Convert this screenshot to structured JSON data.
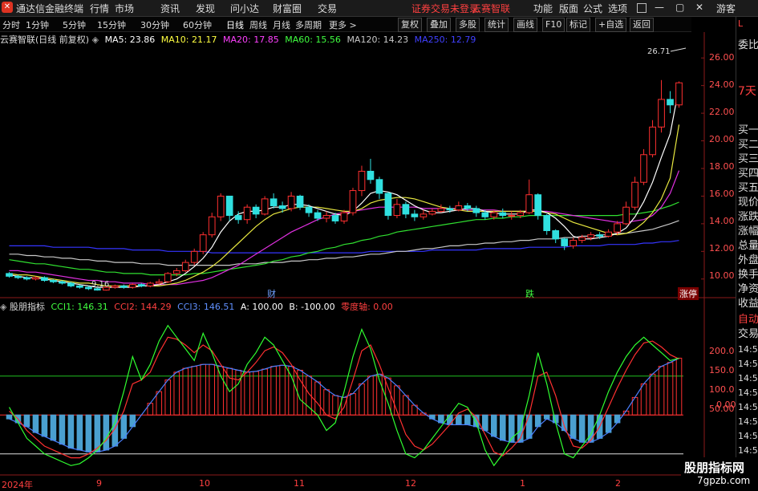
{
  "app": {
    "title": "通达信金融终端",
    "menu": [
      "行情",
      "市场",
      "资讯",
      "发现",
      "问小达",
      "财富圈",
      "交易"
    ],
    "notice": "证券交易未登录",
    "brand": "云赛智联",
    "right_menu": [
      "功能",
      "版面",
      "公式",
      "选项"
    ],
    "guest": "游客"
  },
  "toolbar": {
    "timeframes": [
      "分时",
      "1分钟",
      "5分钟",
      "15分钟",
      "30分钟",
      "60分钟",
      "日线",
      "周线",
      "月线",
      "多周期",
      "更多 >"
    ],
    "active": "日线",
    "buttons": [
      "复权",
      "叠加",
      "多股",
      "统计",
      "画线",
      "F10",
      "标记",
      "+自选",
      "返回"
    ]
  },
  "ma_legend": {
    "name": "云赛智联(日线 前复权)",
    "items": [
      {
        "label": "MA5: 23.86",
        "color": "#ffffff"
      },
      {
        "label": "MA10: 21.17",
        "color": "#ffff40"
      },
      {
        "label": "MA20: 17.85",
        "color": "#ff40ff"
      },
      {
        "label": "MA60: 15.56",
        "color": "#40ff40"
      },
      {
        "label": "MA120: 14.23",
        "color": "#c8c8c8"
      },
      {
        "label": "MA250: 12.79",
        "color": "#4040ff"
      }
    ]
  },
  "cci_legend": {
    "name": "股朋指标",
    "items": [
      {
        "label": "CCI1: 146.31",
        "color": "#40ff40"
      },
      {
        "label": "CCI2: 144.29",
        "color": "#ff4040"
      },
      {
        "label": "CCI3: 146.51",
        "color": "#6090ff"
      },
      {
        "label": "A: 100.00",
        "color": "#ffffff"
      },
      {
        "label": "B: -100.00",
        "color": "#ffffff"
      },
      {
        "label": "零度轴: 0.00",
        "color": "#ff4040"
      }
    ]
  },
  "price_axis": [
    "26.00",
    "24.00",
    "22.00",
    "20.00",
    "18.00",
    "16.00",
    "14.00",
    "12.00",
    "10.00"
  ],
  "cci_axis": [
    "200.0",
    "150.0",
    "100.0",
    "50.00",
    "0.00"
  ],
  "date_axis": [
    "2024年",
    "9",
    "10",
    "11",
    "12",
    "1",
    "2"
  ],
  "annotations": {
    "high": "26.71",
    "low": "9.16",
    "marks": [
      "财",
      "跌",
      "涨停"
    ]
  },
  "side_panel": {
    "top": "L",
    "items": [
      "委比",
      "7天",
      "买一",
      "买二",
      "买三",
      "买四",
      "买五",
      "现价",
      "涨跌",
      "涨幅",
      "总量",
      "外盘",
      "换手",
      "净资",
      "收益"
    ],
    "bottom": [
      "自动",
      "交易"
    ],
    "times": [
      "14:56",
      "14:56",
      "14:56",
      "14:56",
      "14:56",
      "14:56",
      "14:56",
      "14:56"
    ]
  },
  "watermark": {
    "line1": "股朋指标网",
    "line2": "7gpzb.com"
  },
  "chart_data": {
    "type": "candlestick",
    "ylim": [
      9,
      27
    ],
    "cci_ylim": [
      -150,
      250
    ],
    "candles": [
      [
        10.4,
        10.2,
        10.5,
        10.1
      ],
      [
        10.2,
        10.1,
        10.3,
        10.0
      ],
      [
        10.1,
        10.0,
        10.2,
        9.9
      ],
      [
        10.0,
        10.1,
        10.2,
        9.9
      ],
      [
        10.1,
        9.9,
        10.2,
        9.8
      ],
      [
        9.9,
        9.8,
        10.0,
        9.7
      ],
      [
        9.8,
        9.7,
        9.9,
        9.6
      ],
      [
        9.7,
        9.5,
        9.8,
        9.4
      ],
      [
        9.5,
        9.4,
        9.6,
        9.3
      ],
      [
        9.4,
        9.3,
        9.5,
        9.2
      ],
      [
        9.3,
        9.2,
        9.4,
        9.16
      ],
      [
        9.2,
        9.4,
        9.5,
        9.16
      ],
      [
        9.4,
        9.5,
        9.6,
        9.3
      ],
      [
        9.5,
        9.4,
        9.6,
        9.3
      ],
      [
        9.4,
        9.6,
        9.7,
        9.3
      ],
      [
        9.6,
        9.5,
        9.7,
        9.4
      ],
      [
        9.5,
        9.7,
        9.8,
        9.4
      ],
      [
        9.7,
        9.8,
        10.0,
        9.6
      ],
      [
        9.8,
        10.4,
        10.5,
        9.7
      ],
      [
        10.4,
        10.6,
        10.8,
        10.2
      ],
      [
        10.6,
        11.2,
        11.4,
        10.5
      ],
      [
        11.2,
        12.0,
        12.2,
        11.0
      ],
      [
        12.0,
        13.2,
        13.4,
        11.8
      ],
      [
        13.2,
        14.5,
        14.8,
        13.0
      ],
      [
        14.5,
        16.0,
        16.2,
        14.2
      ],
      [
        16.0,
        14.6,
        16.0,
        14.2
      ],
      [
        14.6,
        14.3,
        14.9,
        14.0
      ],
      [
        14.3,
        15.2,
        15.4,
        14.0
      ],
      [
        15.2,
        14.7,
        15.4,
        14.4
      ],
      [
        14.7,
        15.8,
        16.0,
        14.6
      ],
      [
        15.8,
        15.3,
        16.2,
        15.1
      ],
      [
        15.3,
        15.1,
        15.6,
        14.8
      ],
      [
        15.1,
        16.0,
        16.3,
        14.9
      ],
      [
        16.0,
        15.2,
        16.1,
        15.0
      ],
      [
        15.2,
        14.8,
        15.4,
        14.5
      ],
      [
        14.8,
        14.4,
        15.0,
        14.2
      ],
      [
        14.4,
        14.6,
        14.9,
        14.1
      ],
      [
        14.6,
        14.2,
        14.8,
        14.0
      ],
      [
        14.2,
        14.8,
        15.0,
        14.0
      ],
      [
        14.8,
        16.4,
        16.6,
        14.6
      ],
      [
        16.4,
        17.8,
        18.2,
        16.0
      ],
      [
        17.8,
        17.2,
        18.7,
        16.9
      ],
      [
        17.2,
        16.2,
        17.4,
        15.8
      ],
      [
        16.2,
        14.6,
        16.3,
        14.3
      ],
      [
        14.6,
        15.4,
        15.8,
        14.4
      ],
      [
        15.4,
        14.7,
        15.6,
        14.4
      ],
      [
        14.7,
        14.5,
        15.0,
        14.2
      ],
      [
        14.5,
        14.7,
        15.0,
        14.3
      ],
      [
        14.7,
        14.9,
        15.1,
        14.6
      ],
      [
        14.9,
        15.1,
        15.4,
        14.8
      ],
      [
        15.1,
        15.0,
        15.3,
        14.8
      ],
      [
        15.0,
        15.3,
        15.6,
        14.9
      ],
      [
        15.3,
        15.1,
        15.5,
        14.9
      ],
      [
        15.1,
        14.8,
        15.3,
        14.5
      ],
      [
        14.8,
        14.5,
        15.0,
        14.3
      ],
      [
        14.5,
        14.8,
        15.0,
        14.3
      ],
      [
        14.8,
        14.6,
        15.1,
        14.4
      ],
      [
        14.6,
        14.6,
        14.9,
        14.3
      ],
      [
        14.6,
        14.8,
        15.0,
        14.4
      ],
      [
        14.8,
        16.1,
        17.2,
        14.7
      ],
      [
        16.1,
        14.6,
        16.2,
        14.3
      ],
      [
        14.6,
        13.5,
        14.7,
        13.2
      ],
      [
        13.5,
        12.9,
        13.6,
        12.6
      ],
      [
        12.9,
        12.4,
        13.0,
        12.1
      ],
      [
        12.4,
        12.8,
        13.0,
        12.2
      ],
      [
        12.8,
        13.0,
        13.2,
        12.6
      ],
      [
        13.0,
        13.2,
        13.4,
        12.8
      ],
      [
        13.2,
        13.1,
        13.4,
        12.9
      ],
      [
        13.1,
        13.4,
        13.6,
        13.0
      ],
      [
        13.4,
        14.0,
        14.2,
        13.2
      ],
      [
        14.0,
        15.2,
        15.6,
        13.9
      ],
      [
        15.2,
        17.0,
        17.4,
        15.0
      ],
      [
        17.0,
        19.0,
        19.4,
        16.8
      ],
      [
        19.0,
        21.0,
        21.5,
        18.8
      ],
      [
        21.0,
        23.0,
        24.4,
        20.6
      ],
      [
        23.0,
        22.6,
        23.6,
        22.0
      ],
      [
        22.6,
        24.2,
        24.3,
        22.4
      ]
    ],
    "ma5": [
      10.3,
      10.2,
      10.1,
      10.1,
      10.0,
      9.9,
      9.8,
      9.7,
      9.6,
      9.5,
      9.4,
      9.4,
      9.4,
      9.4,
      9.4,
      9.5,
      9.5,
      9.6,
      9.8,
      10.0,
      10.4,
      10.9,
      11.5,
      12.3,
      13.4,
      14.2,
      14.7,
      14.9,
      14.9,
      15.0,
      15.2,
      15.2,
      15.4,
      15.4,
      15.3,
      15.1,
      14.9,
      14.7,
      14.6,
      14.9,
      15.5,
      16.2,
      16.4,
      16.3,
      16.1,
      15.7,
      15.3,
      15.0,
      14.8,
      14.8,
      14.9,
      15.0,
      15.1,
      15.1,
      14.9,
      14.8,
      14.7,
      14.7,
      14.7,
      15.0,
      15.0,
      14.8,
      14.4,
      13.8,
      13.1,
      12.9,
      12.9,
      13.0,
      13.1,
      13.3,
      13.7,
      14.5,
      15.6,
      17.0,
      18.8,
      20.5,
      23.86
    ],
    "ma10": [
      10.4,
      10.3,
      10.3,
      10.2,
      10.1,
      10.0,
      9.9,
      9.8,
      9.7,
      9.7,
      9.6,
      9.5,
      9.5,
      9.5,
      9.5,
      9.5,
      9.5,
      9.5,
      9.6,
      9.7,
      9.9,
      10.2,
      10.5,
      10.9,
      11.4,
      12.0,
      12.6,
      13.2,
      13.8,
      14.3,
      14.7,
      14.9,
      15.1,
      15.2,
      15.2,
      15.2,
      15.1,
      15.0,
      14.9,
      14.9,
      15.1,
      15.5,
      15.7,
      15.8,
      15.9,
      15.9,
      15.8,
      15.6,
      15.4,
      15.2,
      15.1,
      15.0,
      14.9,
      14.9,
      14.9,
      14.9,
      14.9,
      14.9,
      14.9,
      14.9,
      14.9,
      14.8,
      14.7,
      14.4,
      14.1,
      13.9,
      13.7,
      13.5,
      13.3,
      13.2,
      13.3,
      13.6,
      14.1,
      14.8,
      15.8,
      17.3,
      21.17
    ],
    "ma20": [
      10.6,
      10.6,
      10.5,
      10.5,
      10.4,
      10.3,
      10.2,
      10.1,
      10.0,
      9.9,
      9.9,
      9.8,
      9.8,
      9.7,
      9.7,
      9.7,
      9.6,
      9.6,
      9.6,
      9.6,
      9.7,
      9.8,
      9.9,
      10.1,
      10.4,
      10.7,
      11.0,
      11.4,
      11.8,
      12.2,
      12.6,
      13.0,
      13.4,
      13.7,
      14.0,
      14.3,
      14.5,
      14.7,
      14.8,
      14.9,
      15.0,
      15.1,
      15.2,
      15.2,
      15.2,
      15.2,
      15.2,
      15.1,
      15.1,
      15.1,
      15.1,
      15.1,
      15.0,
      15.0,
      15.0,
      15.0,
      14.9,
      14.9,
      14.9,
      14.9,
      14.9,
      14.9,
      14.8,
      14.7,
      14.6,
      14.5,
      14.4,
      14.3,
      14.2,
      14.1,
      14.1,
      14.2,
      14.3,
      14.6,
      15.2,
      16.2,
      17.85
    ],
    "ma60": [
      11.4,
      11.3,
      11.2,
      11.1,
      11.1,
      11.0,
      10.9,
      10.8,
      10.7,
      10.7,
      10.6,
      10.5,
      10.5,
      10.4,
      10.4,
      10.4,
      10.3,
      10.3,
      10.3,
      10.3,
      10.3,
      10.4,
      10.4,
      10.5,
      10.6,
      10.7,
      10.8,
      10.9,
      11.0,
      11.1,
      11.3,
      11.4,
      11.6,
      11.7,
      11.9,
      12.0,
      12.2,
      12.3,
      12.5,
      12.6,
      12.8,
      12.9,
      13.1,
      13.2,
      13.4,
      13.5,
      13.6,
      13.7,
      13.8,
      13.9,
      14.0,
      14.1,
      14.2,
      14.3,
      14.3,
      14.4,
      14.4,
      14.5,
      14.5,
      14.6,
      14.6,
      14.6,
      14.6,
      14.6,
      14.6,
      14.6,
      14.6,
      14.6,
      14.6,
      14.6,
      14.7,
      14.7,
      14.8,
      14.9,
      15.1,
      15.3,
      15.56
    ],
    "ma120": [
      11.8,
      11.8,
      11.7,
      11.7,
      11.6,
      11.6,
      11.5,
      11.5,
      11.4,
      11.4,
      11.3,
      11.3,
      11.2,
      11.2,
      11.2,
      11.1,
      11.1,
      11.1,
      11.0,
      11.0,
      11.0,
      11.0,
      11.0,
      11.0,
      11.0,
      11.0,
      11.1,
      11.1,
      11.1,
      11.2,
      11.2,
      11.2,
      11.3,
      11.3,
      11.4,
      11.4,
      11.5,
      11.5,
      11.6,
      11.6,
      11.7,
      11.8,
      11.8,
      11.9,
      12.0,
      12.0,
      12.1,
      12.2,
      12.2,
      12.3,
      12.4,
      12.4,
      12.5,
      12.5,
      12.6,
      12.6,
      12.7,
      12.7,
      12.8,
      12.8,
      12.9,
      12.9,
      12.9,
      13.0,
      13.0,
      13.1,
      13.1,
      13.2,
      13.2,
      13.3,
      13.3,
      13.4,
      13.5,
      13.6,
      13.8,
      14.0,
      14.23
    ],
    "ma250": [
      12.4,
      12.4,
      12.4,
      12.4,
      12.4,
      12.3,
      12.3,
      12.3,
      12.3,
      12.3,
      12.2,
      12.2,
      12.2,
      12.2,
      12.1,
      12.1,
      12.1,
      12.1,
      12.0,
      12.0,
      12.0,
      12.0,
      12.0,
      11.9,
      11.9,
      11.9,
      11.9,
      11.9,
      11.9,
      11.9,
      11.9,
      11.9,
      11.9,
      11.9,
      11.9,
      11.9,
      11.9,
      11.9,
      11.9,
      11.9,
      11.9,
      12.0,
      12.0,
      12.0,
      12.0,
      12.0,
      12.0,
      12.0,
      12.1,
      12.1,
      12.1,
      12.1,
      12.1,
      12.1,
      12.2,
      12.2,
      12.2,
      12.2,
      12.2,
      12.3,
      12.3,
      12.3,
      12.3,
      12.3,
      12.4,
      12.4,
      12.4,
      12.4,
      12.5,
      12.5,
      12.5,
      12.5,
      12.6,
      12.6,
      12.7,
      12.7,
      12.79
    ],
    "cci1": [
      20,
      -20,
      -60,
      -80,
      -100,
      -110,
      -120,
      -130,
      -125,
      -110,
      -90,
      -60,
      -20,
      60,
      150,
      90,
      130,
      190,
      230,
      200,
      170,
      140,
      210,
      160,
      100,
      60,
      80,
      130,
      160,
      200,
      180,
      140,
      100,
      40,
      20,
      0,
      -40,
      -20,
      60,
      150,
      220,
      170,
      90,
      30,
      -40,
      -100,
      -110,
      -90,
      -60,
      -30,
      0,
      30,
      20,
      -20,
      -90,
      -130,
      -100,
      -60,
      -40,
      50,
      160,
      80,
      -20,
      -100,
      -110,
      -80,
      -50,
      0,
      60,
      110,
      150,
      180,
      200,
      180,
      160,
      140,
      146
    ],
    "cci2": [
      10,
      -10,
      -40,
      -60,
      -80,
      -90,
      -100,
      -110,
      -110,
      -100,
      -85,
      -65,
      -35,
      10,
      80,
      90,
      110,
      160,
      200,
      195,
      180,
      160,
      180,
      165,
      130,
      95,
      90,
      110,
      135,
      165,
      175,
      160,
      130,
      90,
      55,
      30,
      0,
      -10,
      20,
      90,
      165,
      180,
      130,
      70,
      10,
      -50,
      -80,
      -90,
      -75,
      -50,
      -25,
      5,
      15,
      -5,
      -50,
      -95,
      -105,
      -85,
      -60,
      0,
      100,
      110,
      50,
      -30,
      -80,
      -85,
      -65,
      -30,
      20,
      70,
      115,
      155,
      185,
      190,
      175,
      155,
      144
    ],
    "cci3": [
      -10,
      -20,
      -30,
      -45,
      -55,
      -65,
      -75,
      -85,
      -90,
      -95,
      -95,
      -90,
      -80,
      -60,
      -30,
      0,
      30,
      60,
      90,
      110,
      120,
      125,
      130,
      130,
      125,
      120,
      115,
      110,
      112,
      118,
      125,
      128,
      125,
      115,
      100,
      85,
      65,
      50,
      45,
      55,
      80,
      100,
      105,
      95,
      75,
      50,
      25,
      5,
      -10,
      -20,
      -25,
      -25,
      -25,
      -30,
      -40,
      -55,
      -65,
      -70,
      -70,
      -60,
      -30,
      -10,
      -20,
      -40,
      -60,
      -70,
      -70,
      -60,
      -45,
      -20,
      10,
      45,
      80,
      105,
      125,
      135,
      146
    ]
  }
}
